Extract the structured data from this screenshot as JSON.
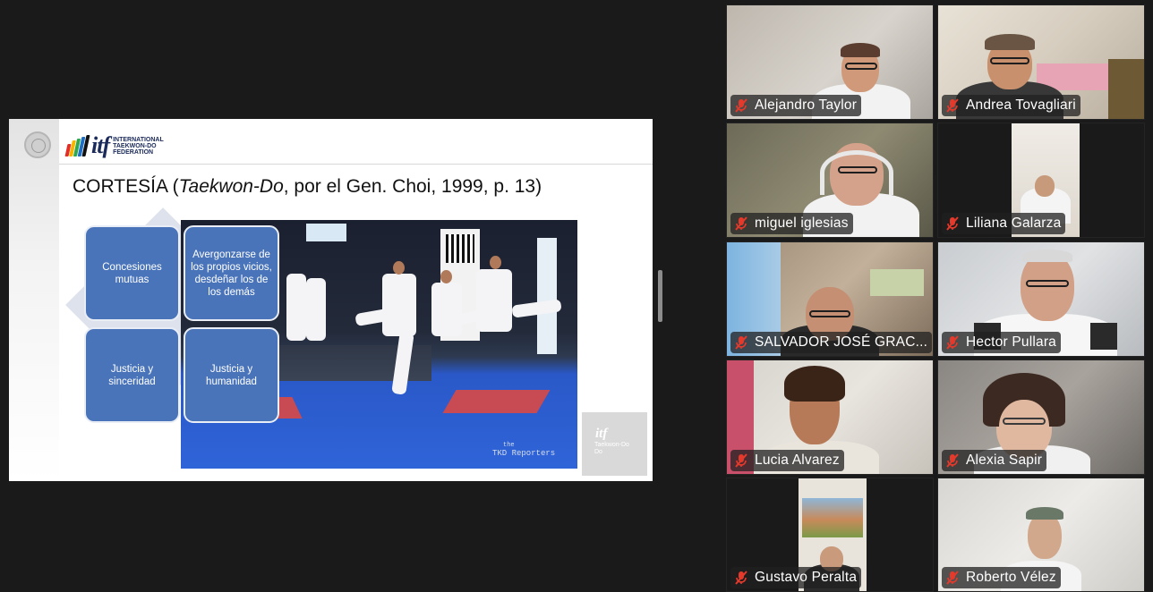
{
  "slide": {
    "logo": {
      "letters": "itf",
      "wordmark": "INTERNATIONAL TAEKWON-DO FEDERATION",
      "stripe_colors": [
        "#e52d27",
        "#f7b500",
        "#2fa84f",
        "#1d6fc4",
        "#111111"
      ]
    },
    "title": {
      "before": "CORTESÍA (",
      "emphasis": "Taekwon-Do",
      "after": ", por el Gen. Choi, 1999, p. 13)"
    },
    "concepts": [
      "Concesiones mutuas",
      "Avergonzarse de los propios vicios, desdeñar los de los demás",
      "Justicia y sinceridad",
      "Justicia y humanidad"
    ],
    "photo": {
      "watermark_small": "the",
      "watermark": "TKD Reporters"
    },
    "corner_logo": {
      "mark": "itf",
      "text": "Taekwon-Do Do"
    },
    "accent_color": "#4a74b9"
  },
  "participants": [
    {
      "name": "Alejandro Taylor",
      "muted": true
    },
    {
      "name": "Andrea Tovagliari",
      "muted": true
    },
    {
      "name": "miguel iglesias",
      "muted": true
    },
    {
      "name": "Liliana Galarza",
      "muted": true
    },
    {
      "name": "SALVADOR JOSÉ GRAC...",
      "muted": true
    },
    {
      "name": "Hector Pullara",
      "muted": true
    },
    {
      "name": "Lucia Alvarez",
      "muted": true
    },
    {
      "name": "Alexia Sapir",
      "muted": true
    },
    {
      "name": "Gustavo Peralta",
      "muted": true
    },
    {
      "name": "Roberto Vélez",
      "muted": true
    }
  ],
  "icons": {
    "muted": "mic-muted-icon",
    "muted_color": "#e5392b"
  }
}
